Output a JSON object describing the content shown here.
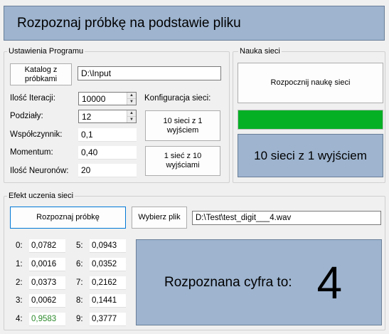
{
  "title": "Rozpoznaj próbkę na podstawie pliku",
  "settings": {
    "legend": "Ustawienia Programu",
    "catalog_button": "Katalog z próbkami",
    "catalog_path": "D:\\Input",
    "iterations_label": "Ilość Iteracji:",
    "iterations_value": "10000",
    "splits_label": "Podziały:",
    "splits_value": "12",
    "coefficient_label": "Współczynnik:",
    "coefficient_value": "0,1",
    "momentum_label": "Momentum:",
    "momentum_value": "0,40",
    "neurons_label": "Ilość Neuronów:",
    "neurons_value": "20",
    "config_label": "Konfiguracja sieci:",
    "config_option_1": "10 sieci z 1 wyjściem",
    "config_option_2": "1 sieć z 10 wyjściami"
  },
  "learning": {
    "legend": "Nauka sieci",
    "start_button": "Rozpocznij naukę sieci",
    "progress_fraction": 1.0,
    "mode_display": "10 sieci z 1 wyjściem"
  },
  "results": {
    "legend": "Efekt uczenia sieci",
    "recognize_button": "Rozpoznaj próbkę",
    "choose_file_button": "Wybierz plik",
    "file_path": "D:\\Test\\test_digit___4.wav",
    "highlight_color": "#2c8a2c",
    "outputs": [
      {
        "label": "0:",
        "value": "0,0782"
      },
      {
        "label": "1:",
        "value": "0,0016"
      },
      {
        "label": "2:",
        "value": "0,0373"
      },
      {
        "label": "3:",
        "value": "0,0062"
      },
      {
        "label": "4:",
        "value": "0,9583",
        "highlight": true
      },
      {
        "label": "5:",
        "value": "0,0943"
      },
      {
        "label": "6:",
        "value": "0,0352"
      },
      {
        "label": "7:",
        "value": "0,2162"
      },
      {
        "label": "8:",
        "value": "0,1441"
      },
      {
        "label": "9:",
        "value": "0,3777"
      }
    ],
    "recognized_label": "Rozpoznana cyfra to:",
    "recognized_digit": "4"
  }
}
